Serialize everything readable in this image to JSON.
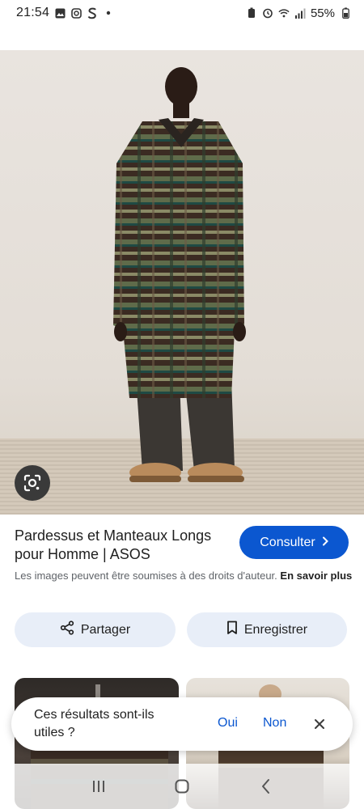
{
  "status_bar": {
    "time": "21:54",
    "left_icons": [
      "gallery-icon",
      "instagram-icon",
      "s-app-icon",
      "dot-icon"
    ],
    "right_icons": [
      "battery-saver-icon",
      "alarm-icon",
      "wifi-icon",
      "signal-icon"
    ],
    "battery": "55%"
  },
  "hero": {
    "subject": "man wearing long checked overcoat",
    "lens_icon": "google-lens-icon"
  },
  "result": {
    "title": "Pardessus et Manteaux Longs pour Homme | ASOS",
    "visit_label": "Consulter",
    "copyright_text": "Les images peuvent être soumises à des droits d'auteur.",
    "learn_more": "En savoir plus"
  },
  "actions": {
    "share_label": "Partager",
    "save_label": "Enregistrer"
  },
  "feedback": {
    "question": "Ces résultats sont-ils utiles ?",
    "yes": "Oui",
    "no": "Non"
  },
  "nav": {
    "items": [
      "recent-apps-icon",
      "home-icon",
      "back-icon"
    ]
  },
  "colors": {
    "accent": "#0b57d0",
    "chip_bg": "#e8eef8",
    "text": "#1f1f1f",
    "muted": "#5f6368"
  }
}
